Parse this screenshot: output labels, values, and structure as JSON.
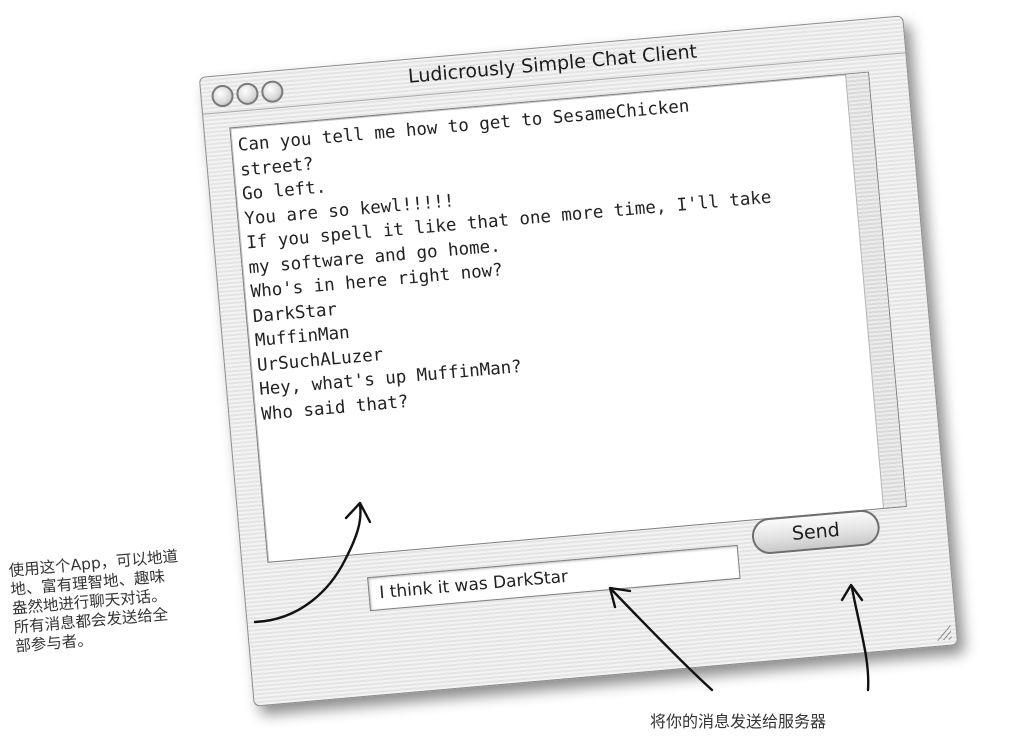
{
  "window": {
    "title": "Ludicrously Simple Chat Client"
  },
  "chat": {
    "messages": [
      "Can you tell me how to get to SesameChicken",
      "street?",
      "Go left.",
      "You are so kewl!!!!!",
      "If you spell it like that one more time, I'll take",
      "my software and go home.",
      "Who's in here right now?",
      "DarkStar",
      "MuffinMan",
      "UrSuchALuzer",
      "Hey, what's up MuffinMan?",
      "Who said that?"
    ]
  },
  "composer": {
    "input_value": "I think it was DarkStar",
    "send_label": "Send"
  },
  "annotations": {
    "left_lines": [
      "使用这个App，可以地道",
      "地、富有理智地、趣味",
      "盎然地进行聊天对话。",
      "所有消息都会发送给全",
      "部参与者。"
    ],
    "bottom": "将你的消息发送给服务器"
  },
  "colors": {
    "window_stripe_light": "#f3f3f3",
    "window_stripe_dark": "#e4e4e4",
    "text": "#222222"
  },
  "icons": [
    "close-button-icon",
    "minimize-button-icon",
    "zoom-button-icon",
    "resize-grip-icon"
  ]
}
